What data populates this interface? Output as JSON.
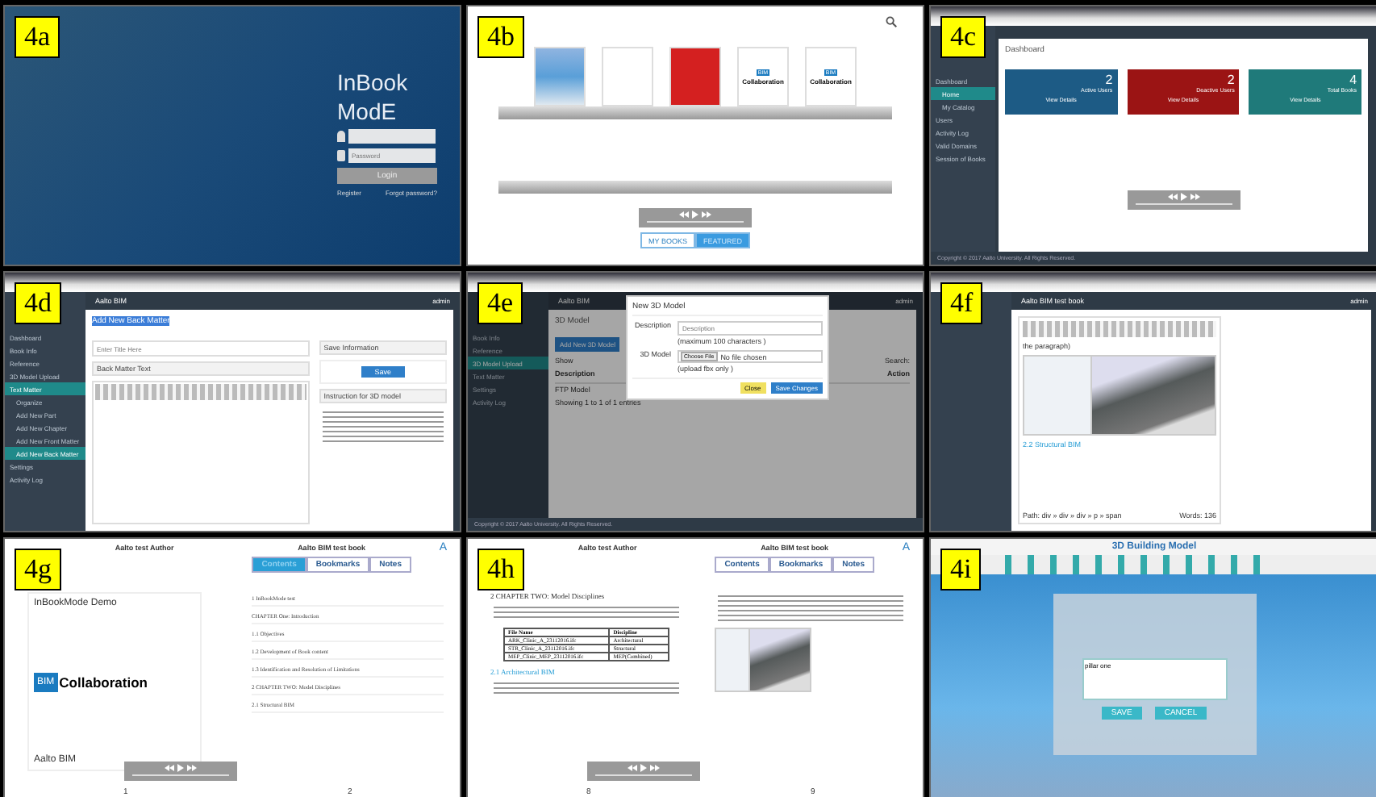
{
  "panels": [
    {
      "kind": "login",
      "label": "4a",
      "title_lines": [
        "InBook",
        "ModE"
      ],
      "password": {
        "placeholder": "Password"
      },
      "login_button": "Login",
      "links": [
        "Register",
        "Forgot password?"
      ]
    },
    {
      "kind": "shelf",
      "label": "4b",
      "books": [
        {
          "kind": "comic"
        },
        {
          "kind": "diagram"
        },
        {
          "kind": "portrait"
        },
        {
          "kind": "bim",
          "badge": "BIM",
          "title": "Collaboration"
        },
        {
          "kind": "bim",
          "badge": "BIM",
          "title": "Collaboration"
        }
      ],
      "tabs": [
        {
          "label": "MY BOOKS",
          "selected": false
        },
        {
          "label": "FEATURED",
          "selected": true
        }
      ]
    },
    {
      "kind": "dashboard",
      "label": "4c",
      "sidebar": [
        {
          "label": "Dashboard",
          "selected": false,
          "children": [
            {
              "label": "Home",
              "selected": true
            },
            {
              "label": "My Catalog",
              "selected": false
            }
          ]
        },
        {
          "label": "Users",
          "selected": false
        },
        {
          "label": "Activity Log",
          "selected": false
        },
        {
          "label": "Valid Domains",
          "selected": false
        },
        {
          "label": "Session of Books",
          "selected": false
        }
      ],
      "heading": "Dashboard",
      "cards": [
        {
          "count": "2",
          "label": "Active Users",
          "link": "View Details",
          "color": "#1d5b85"
        },
        {
          "count": "2",
          "label": "Deactive Users",
          "link": "View Details",
          "color": "#9b1414"
        },
        {
          "count": "4",
          "label": "Total Books",
          "link": "View Details",
          "color": "#1f7a7a"
        }
      ],
      "footer": "Copyright © 2017 Aalto University. All Rights Reserved."
    },
    {
      "kind": "editor",
      "label": "4d",
      "brand": "Aalto BIM",
      "user": "admin",
      "sidebar": [
        {
          "label": "Dashboard",
          "selected": false
        },
        {
          "label": "Book Info",
          "selected": false
        },
        {
          "label": "Reference",
          "selected": false
        },
        {
          "label": "3D Model Upload",
          "selected": false
        },
        {
          "label": "Text Matter",
          "selected": true,
          "children": [
            {
              "label": "Organize",
              "selected": false
            },
            {
              "label": "Add New Part",
              "selected": false
            },
            {
              "label": "Add New Chapter",
              "selected": false
            },
            {
              "label": "Add New Front Matter",
              "selected": false
            },
            {
              "label": "Add New Back Matter",
              "selected": true
            }
          ]
        },
        {
          "label": "Settings",
          "selected": false
        },
        {
          "label": "Activity Log",
          "selected": false
        }
      ],
      "heading": "Add New Back Matter",
      "title_field": {
        "placeholder": "Enter Title Here"
      },
      "text_section": "Back Matter Text",
      "save_section": "Save Information",
      "save_button": "Save",
      "instruction_section": "Instruction for 3D model"
    },
    {
      "kind": "modal",
      "label": "4e",
      "brand": "Aalto BIM",
      "user": "admin",
      "sidebar": [
        {
          "label": "Book Info",
          "selected": false
        },
        {
          "label": "Reference",
          "selected": false
        },
        {
          "label": "3D Model Upload",
          "selected": true
        },
        {
          "label": "Text Matter",
          "selected": false
        },
        {
          "label": "Settings",
          "selected": false
        },
        {
          "label": "Activity Log",
          "selected": false
        }
      ],
      "page_heading": "3D Model",
      "add_button": "Add New 3D Model",
      "show_label": "Show",
      "search_label": "Search:",
      "columns": [
        "Description",
        "Action"
      ],
      "row": "FTP Model",
      "entries": "Showing 1 to 1 of 1 entries",
      "modal": {
        "title": "New 3D Model",
        "description_label": "Description",
        "description_field": {
          "placeholder": "Description"
        },
        "description_hint": "(maximum 100 characters )",
        "model_label": "3D Model",
        "choose_button": "Choose File",
        "no_file": "No file chosen",
        "model_hint": "(upload fbx only )",
        "buttons": [
          "Close",
          "Save Changes"
        ]
      },
      "footer": "Copyright © 2017 Aalto University. All Rights Reserved."
    },
    {
      "kind": "chapter",
      "label": "4f",
      "brand": "Aalto BIM test book",
      "user": "admin",
      "paragraph": "the paragraph)",
      "section_link": "2.2 Structural BIM",
      "path": "Path: div » div » div » p » span",
      "words": "Words: 136"
    },
    {
      "kind": "reader",
      "label": "4g",
      "author": "Aalto test Author",
      "book": "Aalto BIM test book",
      "font_button": "A",
      "tabs": [
        {
          "label": "Contents",
          "selected": true
        },
        {
          "label": "Bookmarks",
          "selected": false
        },
        {
          "label": "Notes",
          "selected": false
        }
      ],
      "cover": {
        "title": "InBookMode Demo",
        "badge": "BIM",
        "logo_text": "Collaboration",
        "footer": "Aalto BIM"
      },
      "contents": [
        "1 InBookMode test",
        "CHAPTER One: Introduction",
        "1.1 Objectives",
        "1.2 Development of Book content",
        "1.3 Identification and Resolution of Limitations",
        "2 CHAPTER TWO: Model Disciplines",
        "2.1 Structural BIM"
      ],
      "page_numbers": [
        "1",
        "2"
      ]
    },
    {
      "kind": "spread",
      "label": "4h",
      "author": "Aalto test Author",
      "book": "Aalto BIM test book",
      "font_button": "A",
      "tabs": [
        {
          "label": "Contents",
          "selected": false
        },
        {
          "label": "Bookmarks",
          "selected": false
        },
        {
          "label": "Notes",
          "selected": false
        }
      ],
      "chapter": "2 CHAPTER TWO: Model Disciplines",
      "table": {
        "columns": [
          "File Name",
          "Discipline"
        ],
        "rows": [
          [
            "ARK_Clinic_A_23112016.ifc",
            "Architectural"
          ],
          [
            "STR_Clinic_A_23112016.ifc",
            "Structural"
          ],
          [
            "MEP_Clinic_MEP_23112016.ifc",
            "MEP(Combined)"
          ]
        ]
      },
      "section": "2.1 Architectural BIM",
      "page_numbers": [
        "8",
        "9"
      ]
    },
    {
      "kind": "model",
      "label": "4i",
      "title": "3D Building Model",
      "note_field": {
        "value": "pillar one"
      },
      "buttons": [
        "SAVE",
        "CANCEL"
      ]
    }
  ]
}
